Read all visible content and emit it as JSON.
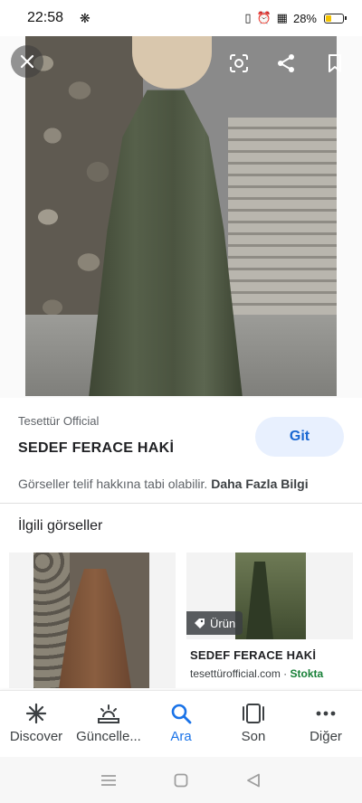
{
  "status_bar": {
    "time": "22:58",
    "battery_text": "28%",
    "battery_level": 0.28,
    "battery_color": "#f5c400"
  },
  "viewer": {
    "close_icon": "close-icon",
    "lens_icon": "google-lens-icon",
    "share_icon": "share-icon",
    "save_icon": "bookmark-icon"
  },
  "result": {
    "source": "Tesettür Official",
    "title": "SEDEF FERACE HAKİ",
    "visit_button": "Git",
    "copyright_text": "Görseller telif hakkına tabi olabilir.",
    "more_info_link": "Daha Fazla Bilgi"
  },
  "related": {
    "heading": "İlgili görseller",
    "items": [
      {},
      {
        "badge": "Ürün",
        "title": "SEDEF FERACE HAKİ",
        "domain": "tesettürofficial.com",
        "separator": " · ",
        "stock": "Stokta"
      }
    ]
  },
  "bottom_nav": {
    "items": [
      {
        "label": "Discover",
        "icon": "asterisk-icon"
      },
      {
        "label": "Güncelle...",
        "icon": "updates-icon"
      },
      {
        "label": "Ara",
        "icon": "search-icon"
      },
      {
        "label": "Son",
        "icon": "recent-tabs-icon"
      },
      {
        "label": "Diğer",
        "icon": "more-icon"
      }
    ],
    "active_index": 2,
    "active_color": "#1a73e8"
  },
  "colors": {
    "accent_blue": "#1a73e8",
    "git_button_bg": "#e8f0fe",
    "stock_green": "#188038"
  }
}
